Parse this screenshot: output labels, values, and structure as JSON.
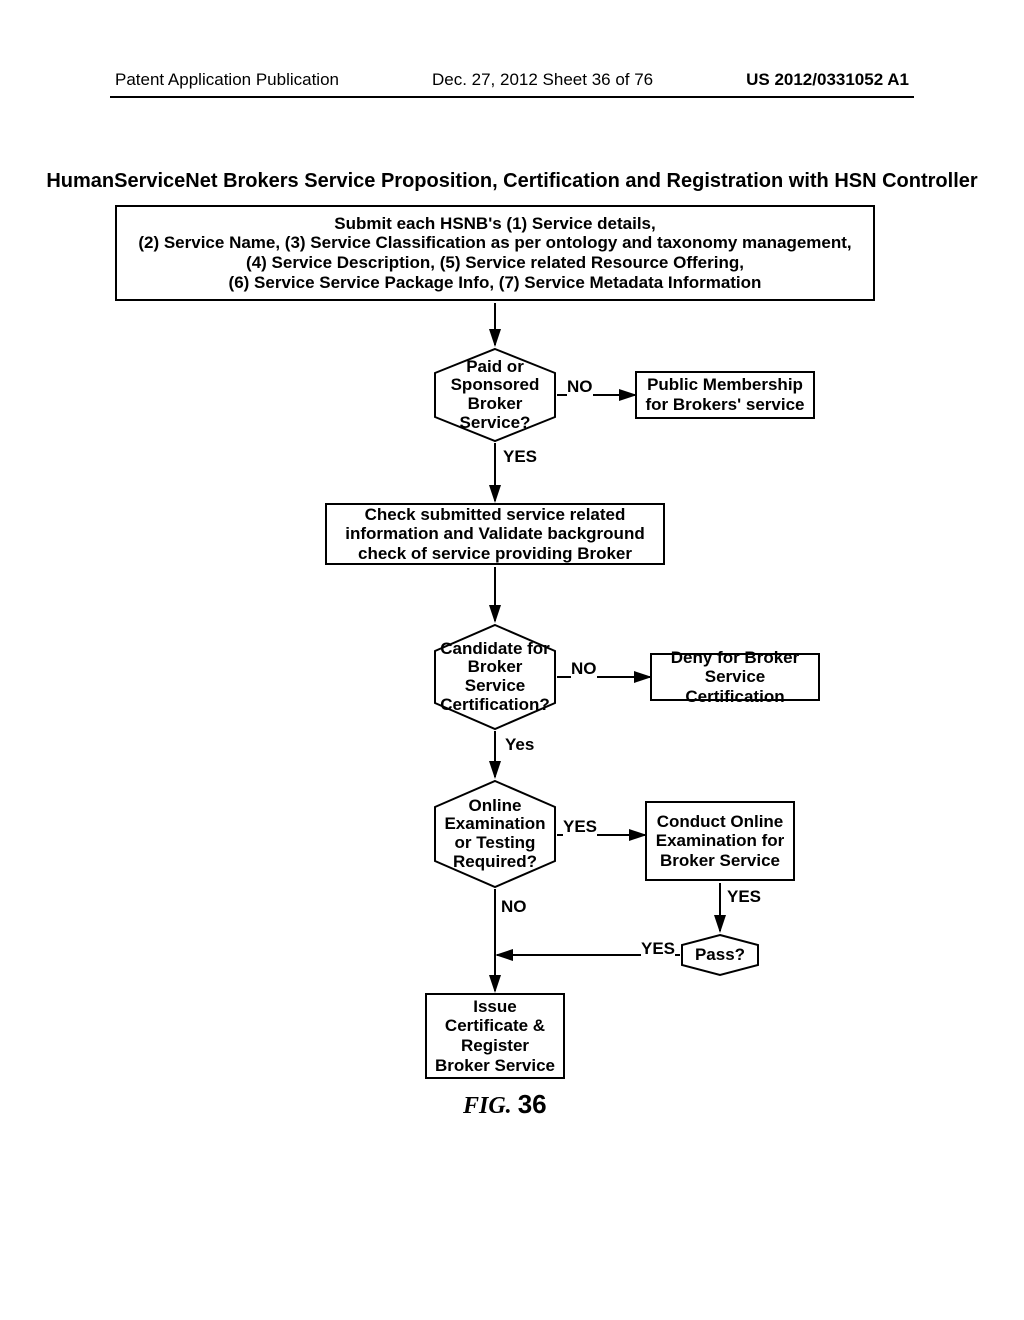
{
  "header": {
    "left": "Patent Application Publication",
    "mid": "Dec. 27, 2012  Sheet 36 of 76",
    "right": "US 2012/0331052 A1"
  },
  "title": "HumanServiceNet Brokers Service Proposition, Certification and Registration with HSN Controller",
  "nodes": {
    "submit": "Submit each HSNB's (1) Service details,\n(2) Service Name, (3) Service Classification as per ontology and taxonomy management,\n(4) Service Description, (5) Service related Resource Offering,\n(6) Service Service Package Info, (7) Service Metadata Information",
    "d1": "Paid or Sponsored Broker Service?",
    "d1_no": "NO",
    "d1_yes": "YES",
    "public": "Public Membership for Brokers' service",
    "check": "Check submitted service related information and Validate background check of service providing Broker",
    "d2": "Candidate for Broker Service Certification?",
    "d2_no": "NO",
    "d2_yes": "Yes",
    "deny": "Deny for Broker Service Certification",
    "d3": "Online Examination or Testing Required?",
    "d3_no": "NO",
    "d3_yes": "YES",
    "conduct": "Conduct Online Examination for Broker Service",
    "conduct_down": "YES",
    "pass": "Pass?",
    "pass_yes": "YES",
    "issue": "Issue Certificate & Register Broker Service"
  },
  "figure": {
    "label": "FIG.",
    "num": "36"
  }
}
